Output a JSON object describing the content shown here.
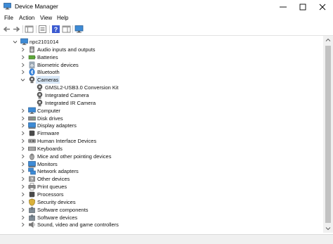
{
  "window": {
    "title": "Device Manager"
  },
  "menu": [
    "File",
    "Action",
    "View",
    "Help"
  ],
  "tree": {
    "root": "npc2101014",
    "categories": [
      "Audio inputs and outputs",
      "Batteries",
      "Biometric devices",
      "Bluetooth",
      "Cameras",
      "Computer",
      "Disk drives",
      "Display adapters",
      "Firmware",
      "Human Interface Devices",
      "Keyboards",
      "Mice and other pointing devices",
      "Monitors",
      "Network adapters",
      "Other devices",
      "Print queues",
      "Processors",
      "Security devices",
      "Software components",
      "Software devices",
      "Sound, video and game controllers"
    ],
    "camera_children": [
      "GMSL2-USB3.0 Conversion Kit",
      "Integrated Camera",
      "Integrated IR Camera"
    ],
    "expanded_category": "Cameras",
    "selected": "Cameras"
  },
  "colors": {
    "selection": "#d9e8f7",
    "accent": "#1a73c8"
  }
}
